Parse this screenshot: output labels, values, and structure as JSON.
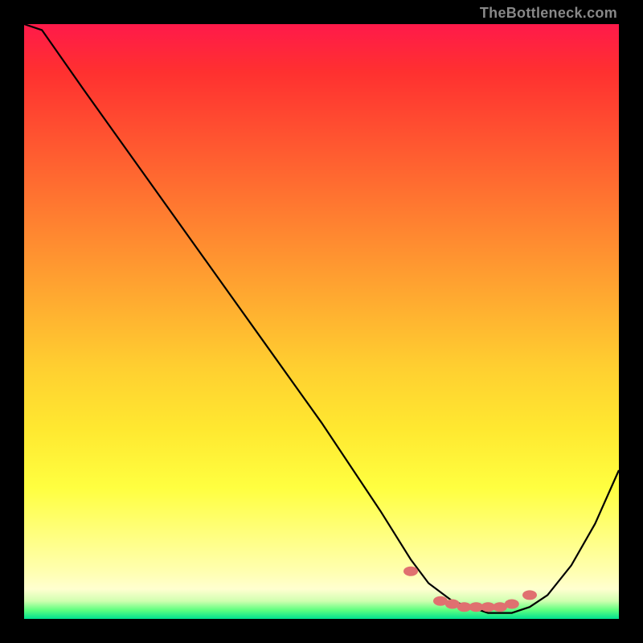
{
  "attribution": "TheBottleneck.com",
  "chart_data": {
    "type": "line",
    "title": "",
    "xlabel": "",
    "ylabel": "",
    "xlim": [
      0,
      100
    ],
    "ylim": [
      0,
      100
    ],
    "series": [
      {
        "name": "curve",
        "x": [
          0,
          3,
          10,
          20,
          30,
          40,
          50,
          60,
          65,
          68,
          72,
          78,
          82,
          85,
          88,
          92,
          96,
          100
        ],
        "values": [
          100,
          99,
          89,
          75,
          61,
          47,
          33,
          18,
          10,
          6,
          3,
          1,
          1,
          2,
          4,
          9,
          16,
          25
        ],
        "color": "#000000"
      }
    ],
    "markers": {
      "name": "highlight-points",
      "x": [
        65,
        70,
        72,
        74,
        76,
        78,
        80,
        82,
        85
      ],
      "values": [
        8,
        3,
        2.5,
        2,
        2,
        2,
        2,
        2.5,
        4
      ],
      "color": "#e07070"
    }
  }
}
